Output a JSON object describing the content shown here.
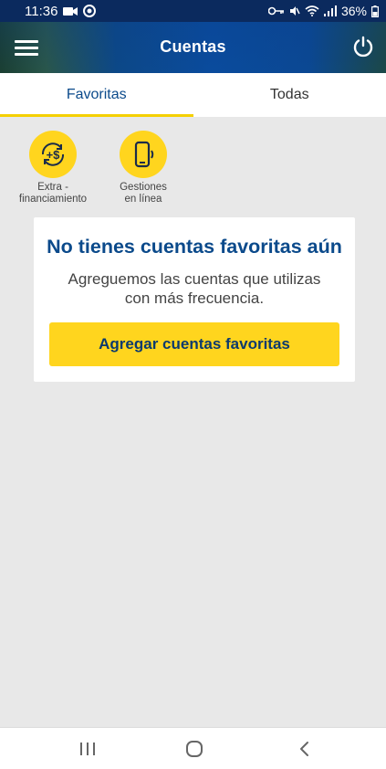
{
  "status_bar": {
    "time": "11:36",
    "battery": "36%",
    "icons": [
      "video-icon",
      "notification-icon",
      "key-icon",
      "mute-icon",
      "wifi-icon",
      "signal-icon",
      "battery-icon"
    ]
  },
  "app_bar": {
    "title": "Cuentas",
    "menu_icon": "hamburger-menu-icon",
    "power_icon": "power-icon"
  },
  "tabs": [
    {
      "label": "Favoritas",
      "active": true
    },
    {
      "label": "Todas",
      "active": false
    }
  ],
  "shortcuts": [
    {
      "line1": "Extra -",
      "line2": "financiamiento",
      "icon": "money-refresh-icon"
    },
    {
      "line1": "Gestiones",
      "line2": "en línea",
      "icon": "phone-signal-icon"
    }
  ],
  "empty_state": {
    "title": "No tienes cuentas favoritas aún",
    "text_line1": "Agreguemos las cuentas que utilizas",
    "text_line2": "con más frecuencia.",
    "button_label": "Agregar cuentas favoritas"
  },
  "navigation": {
    "icons": [
      "recent-apps-icon",
      "home-icon",
      "back-icon"
    ]
  },
  "colors": {
    "brand_blue": "#0b4a8b",
    "accent_yellow": "#ffd51e",
    "background": "#e8e8e8"
  }
}
